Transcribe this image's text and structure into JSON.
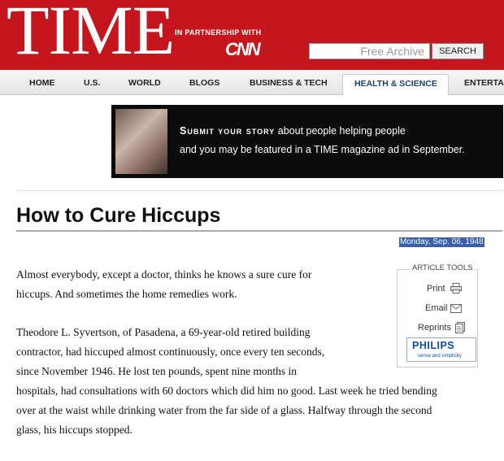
{
  "header": {
    "logo": "TIME",
    "partner_text": "IN PARTNERSHIP WITH",
    "partner_logo": "CNN",
    "search_placeholder": "Free Archive",
    "search_button": "SEARCH",
    "brand_color": "#c4161c"
  },
  "nav": {
    "items": [
      "HOME",
      "U.S.",
      "WORLD",
      "BLOGS",
      "BUSINESS & TECH",
      "HEALTH & SCIENCE",
      "ENTERTA"
    ],
    "active": "HEALTH & SCIENCE"
  },
  "banner": {
    "headline": "Submit your story",
    "line1_rest": " about people helping people",
    "line2": "and you may be featured in a TIME magazine ad in September."
  },
  "article": {
    "title": "How to Cure Hiccups",
    "date": "Monday, Sep. 06, 1948",
    "para1": [
      "Almost everybody, except a doctor, thinks he knows a sure cure for",
      "hiccups. And sometimes the home remedies work."
    ],
    "para2": [
      "Theodore L. Syvertson, of Pasadena, a 69-year-old retired building",
      "contractor, had hiccuped almost continuously, once every ten seconds,",
      "since November 1946. He lost ten pounds, spent nine months in",
      "hospitals, had consultations with 60 doctors which did him no good. Last week he tried bending",
      "over at the waist while drinking water from the far side of a glass. Halfway through the second",
      "glass, his hiccups stopped."
    ]
  },
  "tools": {
    "heading": "ARTICLE TOOLS",
    "print": "Print",
    "email": "Email",
    "reprints": "Reprints",
    "sponsor": "PHILIPS",
    "sponsor_tagline": "sense and simplicity"
  }
}
